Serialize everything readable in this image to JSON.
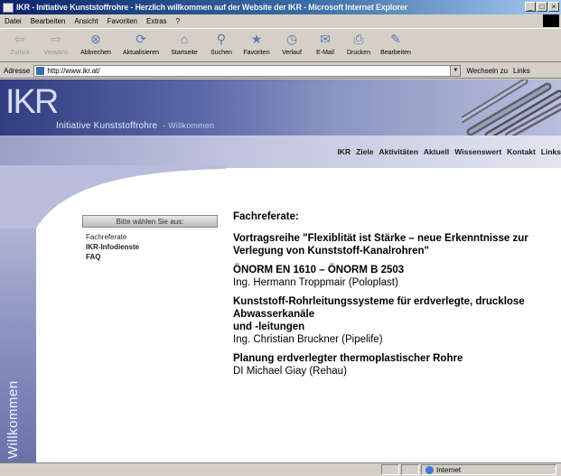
{
  "window": {
    "title": "IKR - Initiative Kunststoffrohre - Herzlich willkommen auf der Website der IKR - Microsoft Internet Explorer",
    "min": "_",
    "max": "□",
    "close": "×"
  },
  "menubar": {
    "items": [
      "Datei",
      "Bearbeiten",
      "Ansicht",
      "Favoriten",
      "Extras",
      "?"
    ]
  },
  "toolbar": {
    "buttons": [
      {
        "label": "Zurück",
        "icon": "back-arrow-icon",
        "glyph": "⇦",
        "disabled": true
      },
      {
        "label": "Vorwärts",
        "icon": "forward-arrow-icon",
        "glyph": "⇨",
        "disabled": true
      },
      {
        "label": "Abbrechen",
        "icon": "stop-icon",
        "glyph": "⊗",
        "disabled": false
      },
      {
        "label": "Aktualisieren",
        "icon": "refresh-icon",
        "glyph": "⟳",
        "disabled": false
      },
      {
        "label": "Startseite",
        "icon": "home-icon",
        "glyph": "⌂",
        "disabled": false
      },
      {
        "label": "Suchen",
        "icon": "search-icon",
        "glyph": "⚲",
        "disabled": false
      },
      {
        "label": "Favoriten",
        "icon": "favorites-icon",
        "glyph": "★",
        "disabled": false
      },
      {
        "label": "Verlauf",
        "icon": "history-icon",
        "glyph": "◷",
        "disabled": false
      },
      {
        "label": "E-Mail",
        "icon": "mail-icon",
        "glyph": "✉",
        "disabled": false
      },
      {
        "label": "Drucken",
        "icon": "print-icon",
        "glyph": "⎙",
        "disabled": false
      },
      {
        "label": "Bearbeiten",
        "icon": "edit-icon",
        "glyph": "✎",
        "disabled": false
      }
    ]
  },
  "address": {
    "label": "Adresse",
    "url": "http://www.ikr.at/",
    "go": "Wechseln zu",
    "links": "Links"
  },
  "banner": {
    "logo": "IKR",
    "tagline": "Initiative Kunststoffrohre",
    "sub": "- Willkommen"
  },
  "topnav": {
    "items": [
      "IKR",
      "Ziele",
      "Aktivitäten",
      "Aktuell",
      "Wissenswert",
      "Kontakt",
      "Links"
    ]
  },
  "side_vertical": "Willkommen",
  "sidebox": {
    "header": "Bitte wählen Sie aus:",
    "items": [
      {
        "label": "Fachreferate",
        "bold": false
      },
      {
        "label": "IKR-Infodienste",
        "bold": true
      },
      {
        "label": "FAQ",
        "bold": true
      }
    ]
  },
  "content": {
    "heading": "Fachreferate:",
    "blocks": [
      {
        "title": "Vortragsreihe \"Flexiblität ist Stärke – neue Erkenntnisse zur Verlegung von Kunststoff-Kanalrohren\"",
        "speaker": ""
      },
      {
        "title": "ÖNORM EN 1610 – ÖNORM B 2503",
        "speaker": "Ing. Hermann Troppmair (Poloplast)"
      },
      {
        "title": "Kunststoff-Rohrleitungssysteme für erdverlegte, drucklose Abwasserkanäle",
        "title2": "und -leitungen",
        "speaker": "Ing. Christian Bruckner (Pipelife)"
      },
      {
        "title": "Planung erdverlegter thermoplastischer Rohre",
        "speaker": "DI Michael Giay (Rehau)"
      }
    ]
  },
  "statusbar": {
    "zone": "Internet"
  },
  "colors": {
    "titlebar": "#0a246a",
    "banner": "#2f3e80",
    "chrome": "#d4d0c8"
  }
}
